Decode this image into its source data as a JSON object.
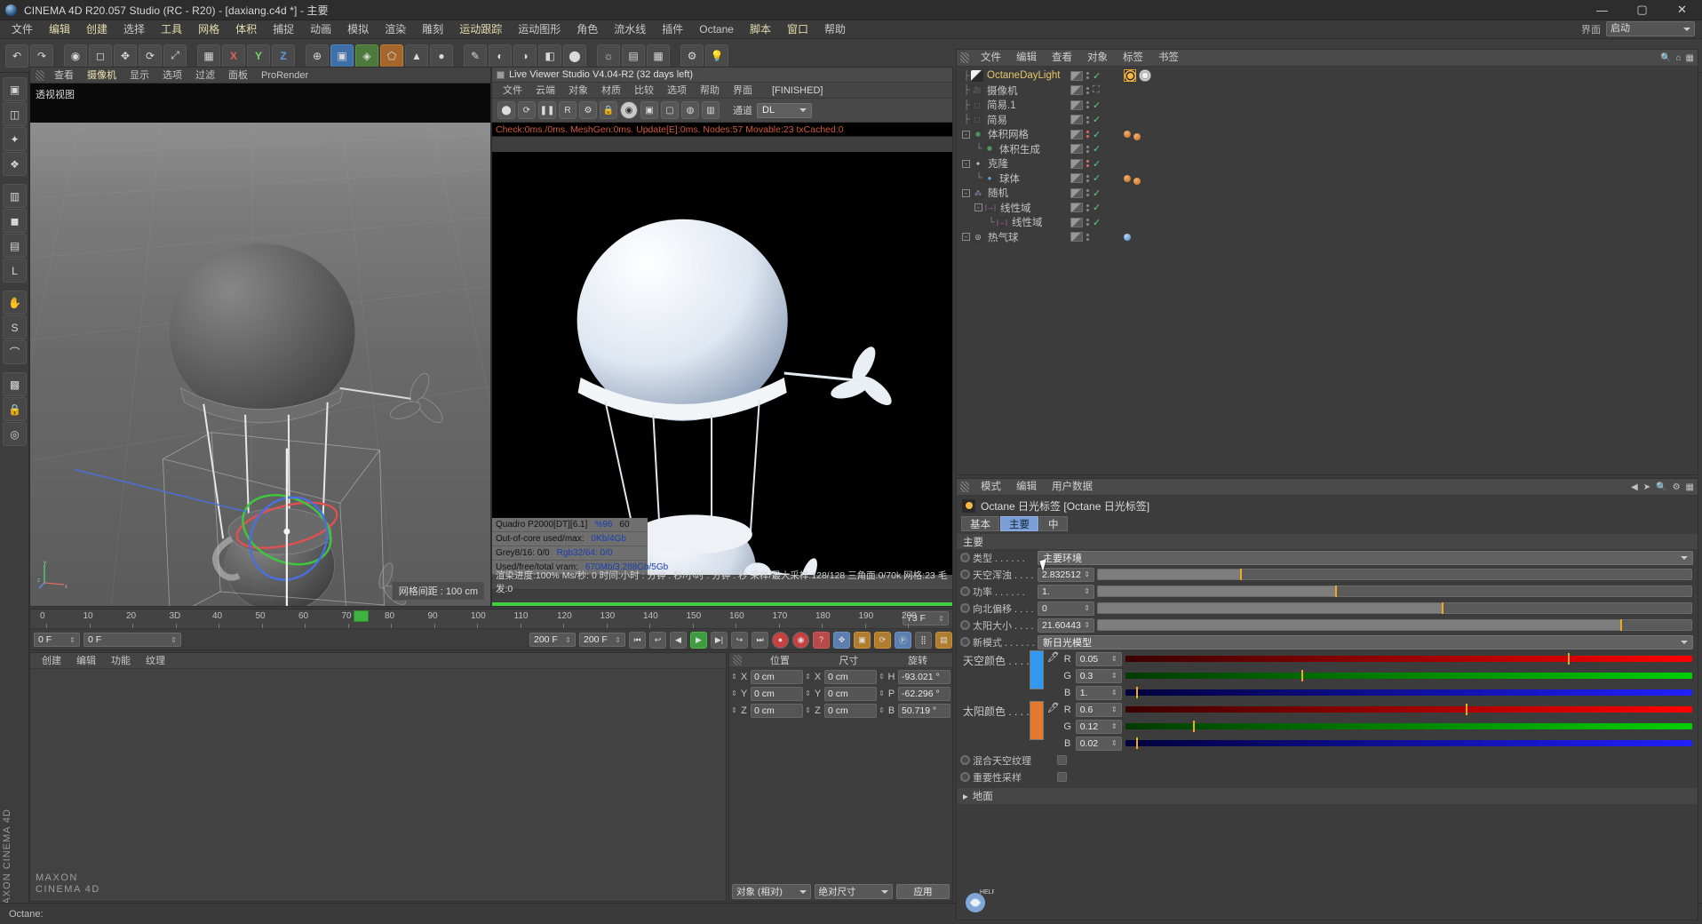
{
  "titlebar": {
    "title": "CINEMA 4D R20.057 Studio (RC - R20) - [daxiang.c4d *] - 主要",
    "minimize": "—",
    "maximize": "▢",
    "close": "✕"
  },
  "menubar": {
    "items": [
      "文件",
      "编辑",
      "创建",
      "选择",
      "工具",
      "网格",
      "体积",
      "捕捉",
      "动画",
      "模拟",
      "渲染",
      "雕刻",
      "运动跟踪",
      "运动图形",
      "角色",
      "流水线",
      "插件",
      "Octane",
      "脚本",
      "窗口",
      "帮助"
    ],
    "highlighted": [
      "编辑",
      "创建",
      "工具",
      "网格",
      "体积",
      "运动跟踪",
      "脚本",
      "窗口"
    ],
    "layout_label": "界面",
    "layout_value": "启动"
  },
  "toolbar": {
    "buttons": [
      "↶",
      "↷",
      "◉",
      "◻",
      "✥",
      "⟳",
      "⤢",
      "▦",
      "X",
      "Y",
      "Z",
      "⊕",
      "▣",
      "◈",
      "⬠",
      "▲",
      "●",
      "✎",
      "◐",
      "◑",
      "◧",
      "⬤",
      "☼",
      "▤",
      "▦",
      "⚙",
      "💡"
    ]
  },
  "left_tools": {
    "buttons": [
      "▣",
      "◫",
      "✦",
      "❖",
      "▥",
      "◼",
      "▤",
      "L",
      "✋",
      "S",
      "⌒",
      "▩",
      "🔒",
      "◎"
    ],
    "brand": "MAXON CINEMA 4D"
  },
  "viewport": {
    "menus": [
      "查看",
      "摄像机",
      "显示",
      "选项",
      "过滤",
      "面板",
      "ProRender"
    ],
    "active_menu": "摄像机",
    "label": "透视视图",
    "grid_info": "网格间距 : 100 cm",
    "axis_z": "z",
    "axis_y": "y",
    "axis_x": "x"
  },
  "live_viewer": {
    "title": "Live Viewer Studio V4.04-R2 (32 days left)",
    "menus": [
      "文件",
      "云端",
      "对象",
      "材质",
      "比较",
      "选项",
      "帮助",
      "界面"
    ],
    "status": "[FINISHED]",
    "toolbar_icons": [
      "⬤",
      "⟳",
      "❚❚",
      "R",
      "⚙",
      "🔒",
      "◉",
      "▣",
      "▢",
      "◍",
      "▥"
    ],
    "channel_label": "通道",
    "channel_value": "DL",
    "stat_line": "Check:0ms./0ms. MeshGen:0ms. Update[E]:0ms. Nodes:57 Movable:23 txCached:0",
    "overlay": [
      {
        "a": "Quadro P2000[DT][6.1]",
        "b": "%96",
        "c": "60"
      },
      {
        "a": "Out-of-core used/max:",
        "b": "0Kb/4Gb",
        "c": ""
      },
      {
        "a": "Grey8/16: 0/0",
        "b": "Rgb32/64: 0/0",
        "c": ""
      },
      {
        "a": "Used/free/total vram:",
        "b": "670Mb/3.288Gb/5Gb",
        "c": ""
      }
    ],
    "footer_line1": "渲染进度:100%   Ms/秒: 0      时间:小时 : 分钟 : 秒/小时 : 分钟 : 秒   采样/最大采样:128/128    三角面:0/70k  网格:23  毛发:0"
  },
  "timeline": {
    "ticks": [
      "0",
      "10",
      "20",
      "3D",
      "40",
      "50",
      "60",
      "70",
      "80",
      "90",
      "100",
      "110",
      "120",
      "130",
      "140",
      "150",
      "160",
      "170",
      "180",
      "190",
      "200"
    ],
    "current_frame_label": "73 F",
    "range_end": "200 F",
    "frame_field": "0 F",
    "frame_field2": "0 F",
    "range_field": "200 F",
    "playhead_frame": "73"
  },
  "material_manager": {
    "menus": [
      "创建",
      "编辑",
      "功能",
      "纹理"
    ]
  },
  "coordinates": {
    "headers": [
      "位置",
      "尺寸",
      "旋转"
    ],
    "rows": [
      {
        "axis": "X",
        "pos": "0 cm",
        "size": "0 cm",
        "rot_label": "H",
        "rot": "-93.021 °"
      },
      {
        "axis": "Y",
        "pos": "0 cm",
        "size": "0 cm",
        "rot_label": "P",
        "rot": "-62.296 °"
      },
      {
        "axis": "Z",
        "pos": "0 cm",
        "size": "0 cm",
        "rot_label": "B",
        "rot": "50.719 °"
      }
    ],
    "mode1": "对象 (相对)",
    "mode2": "绝对尺寸",
    "apply": "应用"
  },
  "statusbar": {
    "text": "Octane:"
  },
  "object_manager": {
    "menus": [
      "文件",
      "编辑",
      "查看",
      "对象",
      "标签",
      "书签"
    ],
    "items": [
      {
        "name": "OctaneDayLight",
        "depth": 0,
        "selected": true,
        "icon": "pen",
        "icon_color": "#d8d8d8",
        "expand": null,
        "tag_check": true,
        "dot_red": false,
        "rtags": [
          "sun",
          "gear"
        ]
      },
      {
        "name": "摄像机",
        "depth": 0,
        "selected": false,
        "icon": "camera",
        "icon_color": "#5b7fc0",
        "expand": null,
        "tag_check": false,
        "dot_red": false,
        "rtags": []
      },
      {
        "name": "简易.1",
        "depth": 0,
        "selected": false,
        "icon": "effector",
        "icon_color": "#6e83c0",
        "expand": null,
        "tag_check": true,
        "dot_red": false,
        "rtags": []
      },
      {
        "name": "简易",
        "depth": 0,
        "selected": false,
        "icon": "effector",
        "icon_color": "#6e83c0",
        "expand": null,
        "tag_check": true,
        "dot_red": false,
        "rtags": []
      },
      {
        "name": "体积网格",
        "depth": 0,
        "selected": false,
        "icon": "volume",
        "icon_color": "#5fc06b",
        "expand": "-",
        "tag_check": true,
        "dot_red": true,
        "rtags": [
          "or",
          "or"
        ]
      },
      {
        "name": "体积生成",
        "depth": 1,
        "selected": false,
        "icon": "volume2",
        "icon_color": "#5fc06b",
        "expand": null,
        "tag_check": true,
        "dot_red": false,
        "rtags": []
      },
      {
        "name": "克隆",
        "depth": 0,
        "selected": false,
        "icon": "cloner",
        "icon_color": "#a8d8b0",
        "expand": "-",
        "tag_check": true,
        "dot_red": true,
        "rtags": []
      },
      {
        "name": "球体",
        "depth": 1,
        "selected": false,
        "icon": "sphere",
        "icon_color": "#5ea9e8",
        "expand": null,
        "tag_check": true,
        "dot_red": false,
        "rtags": [
          "or",
          "or"
        ]
      },
      {
        "name": "随机",
        "depth": 0,
        "selected": false,
        "icon": "random",
        "icon_color": "#9aa8d0",
        "expand": "-",
        "tag_check": true,
        "dot_red": false,
        "rtags": []
      },
      {
        "name": "线性域",
        "depth": 1,
        "selected": false,
        "icon": "field",
        "icon_color": "#c060c0",
        "expand": "-",
        "tag_check": true,
        "dot_red": false,
        "rtags": []
      },
      {
        "name": "线性域",
        "depth": 2,
        "selected": false,
        "icon": "field",
        "icon_color": "#c060c0",
        "expand": null,
        "tag_check": true,
        "dot_red": false,
        "rtags": []
      },
      {
        "name": "热气球",
        "depth": 0,
        "selected": false,
        "icon": "null",
        "icon_color": "#d8d8d8",
        "expand": "-",
        "tag_check": false,
        "dot_red": false,
        "rtags": [
          "bl"
        ]
      }
    ]
  },
  "attribute_manager": {
    "menus": [
      "模式",
      "编辑",
      "用户数据"
    ],
    "object_title": "Octane 日光标签 [Octane 日光标签]",
    "tabs": [
      "基本",
      "主要",
      "中"
    ],
    "active_tab": "主要",
    "section": "主要",
    "params": [
      {
        "label": "类型",
        "type": "dropdown",
        "value": "主要环境"
      },
      {
        "label": "天空浑浊",
        "type": "numslider",
        "value": "2.832512",
        "knob_pct": 24
      },
      {
        "label": "功率",
        "type": "numslider",
        "value": "1.",
        "knob_pct": 40
      },
      {
        "label": "向北偏移",
        "type": "numslider",
        "value": "0",
        "knob_pct": 58
      },
      {
        "label": "太阳大小",
        "type": "numslider",
        "value": "21.60443",
        "knob_pct": 88
      },
      {
        "label": "新模式",
        "type": "dropdown",
        "value": "新日光模型"
      }
    ],
    "sky_color": {
      "label": "天空颜色",
      "swatch": "#3399f0",
      "R": "0.05",
      "G": "0.3",
      "B": "1.",
      "r_mark_pct": 78,
      "g_mark_pct": 31,
      "b_mark_pct": 2
    },
    "sun_color": {
      "label": "太阳颜色",
      "swatch": "#e2792e",
      "R": "0.6",
      "G": "0.12",
      "B": "0.02",
      "r_mark_pct": 60,
      "g_mark_pct": 12,
      "b_mark_pct": 2
    },
    "checkboxes": [
      {
        "label": "混合天空纹理",
        "checked": false
      },
      {
        "label": "重要性采样",
        "checked": false
      }
    ],
    "fold": "地面",
    "help": "HELP"
  }
}
